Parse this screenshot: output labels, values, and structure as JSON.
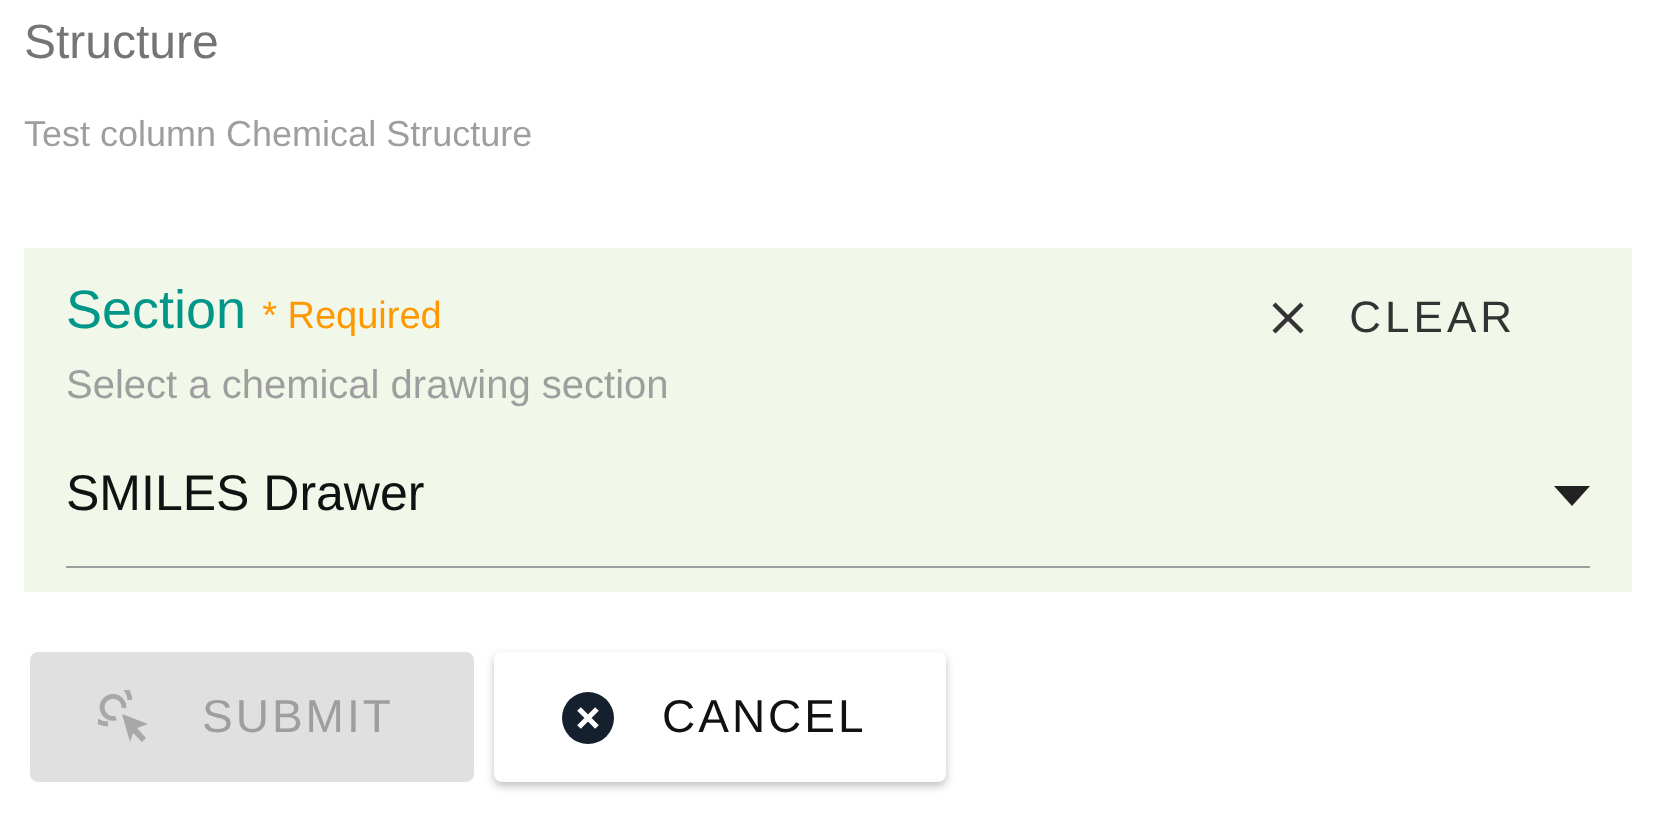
{
  "header": {
    "title": "Structure",
    "description": "Test column Chemical Structure"
  },
  "section": {
    "label": "Section",
    "required_mark": "* Required",
    "clear_button": "CLEAR",
    "hint": "Select a chemical drawing section",
    "value": "SMILES Drawer"
  },
  "buttons": [
    {
      "kind": "submit",
      "label": "SUBMIT",
      "disabled": true
    },
    {
      "kind": "cancel",
      "label": "CANCEL",
      "disabled": false
    }
  ]
}
